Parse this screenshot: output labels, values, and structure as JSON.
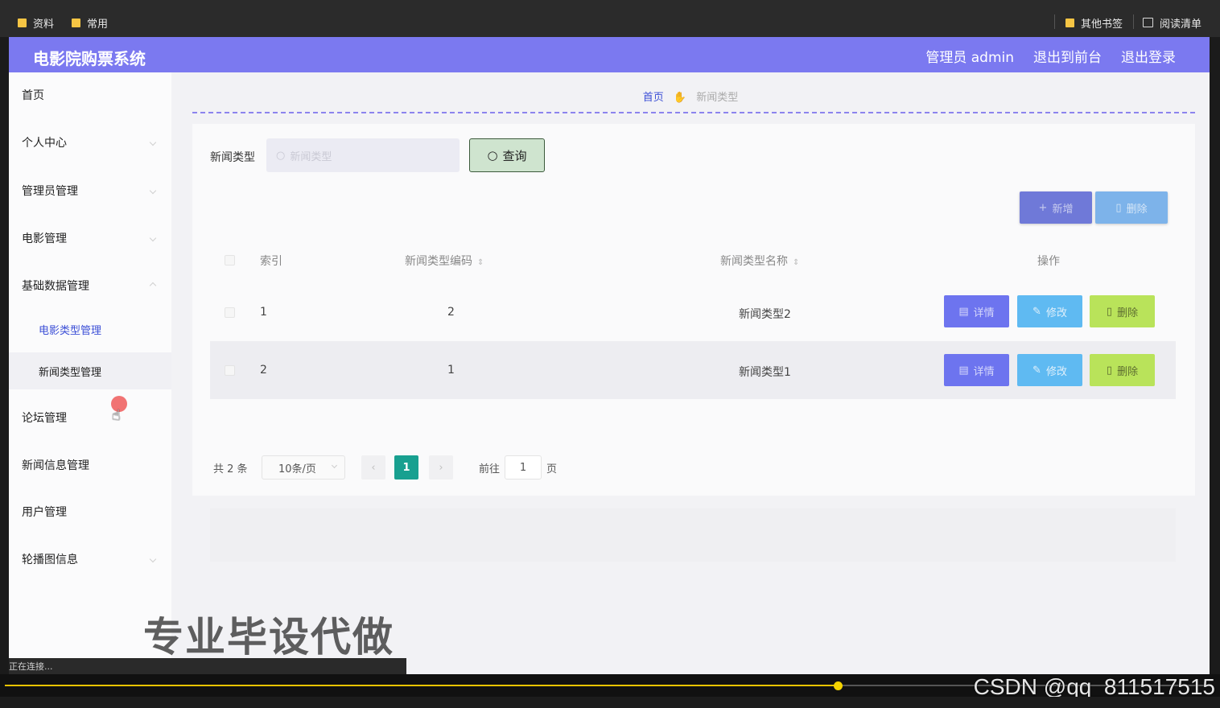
{
  "browser": {
    "bookmarks": [
      "资料",
      "常用"
    ],
    "right_bookmarks": [
      "其他书签",
      "阅读清单"
    ]
  },
  "header": {
    "title": "电影院购票系统",
    "links": [
      "管理员 admin",
      "退出到前台",
      "退出登录"
    ]
  },
  "sidebar": {
    "items": [
      "首页",
      "个人中心",
      "管理员管理",
      "电影管理",
      "基础数据管理",
      "论坛管理",
      "新闻信息管理",
      "用户管理",
      "轮播图信息"
    ],
    "sub_items": [
      "电影类型管理",
      "新闻类型管理"
    ]
  },
  "breadcrumb": {
    "home": "首页",
    "current": "新闻类型"
  },
  "search": {
    "label": "新闻类型",
    "placeholder": "新闻类型",
    "button": "查询"
  },
  "toolbar": {
    "add": "新增",
    "delete": "删除"
  },
  "table": {
    "headers": [
      "索引",
      "新闻类型编码",
      "新闻类型名称",
      "操作"
    ],
    "rows": [
      {
        "index": "1",
        "code": "2",
        "name": "新闻类型2"
      },
      {
        "index": "2",
        "code": "1",
        "name": "新闻类型1"
      }
    ],
    "actions": {
      "detail": "详情",
      "edit": "修改",
      "delete": "删除"
    }
  },
  "pagination": {
    "total": "共 2 条",
    "page_size": "10条/页",
    "current": "1",
    "goto_label": "前往",
    "goto_value": "1",
    "unit": "页"
  },
  "overlay": {
    "watermark": "专业毕设代做",
    "status": "正在连接...",
    "csdn": "CSDN @qq_811517515",
    "video_progress": 0.69
  },
  "colors": {
    "header": "#7b79f0",
    "accent": "#3c4fd6",
    "pager_active": "#18a090"
  }
}
